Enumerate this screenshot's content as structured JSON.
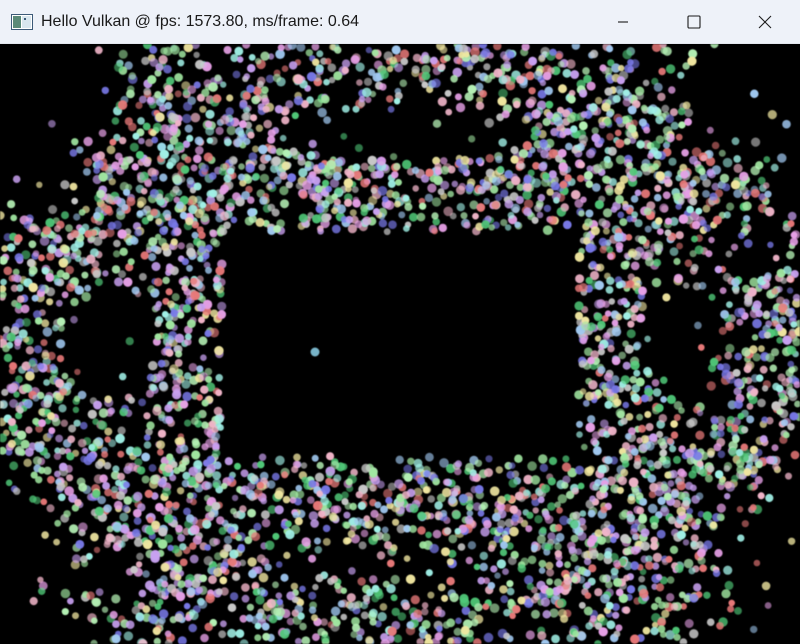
{
  "window": {
    "title": "Hello Vulkan @ fps: 1573.80, ms/frame: 0.64",
    "icon": "app-window-icon",
    "controls": {
      "minimize": "minimize-icon",
      "maximize": "maximize-icon",
      "close": "close-icon"
    }
  },
  "scene": {
    "background": "#000000",
    "description_icon": "particle-field",
    "palette": [
      "#e6a0e6",
      "#a0e6a0",
      "#a0c8f0",
      "#f0e6a0",
      "#c8a0f0",
      "#a0f0e6",
      "#f0b4c8",
      "#b4f0b4",
      "#7878e6",
      "#50c878",
      "#e67878",
      "#c8c8c8"
    ]
  }
}
